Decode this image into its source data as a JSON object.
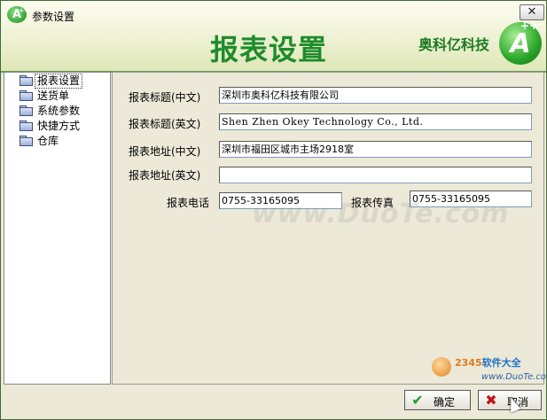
{
  "window": {
    "title": "参数设置",
    "close_label": "✕"
  },
  "banner": {
    "page_title": "报表设置",
    "company": "奥科亿科技",
    "logo_letter": "A",
    "logo_plus": "++"
  },
  "sidebar": {
    "items": [
      {
        "label": "报表设置",
        "selected": true
      },
      {
        "label": "送货单",
        "selected": false
      },
      {
        "label": "系统参数",
        "selected": false
      },
      {
        "label": "快捷方式",
        "selected": false
      },
      {
        "label": "仓库",
        "selected": false
      }
    ]
  },
  "form": {
    "title_cn_label": "报表标题(中文)",
    "title_cn_value": "深圳市奥科亿科技有限公司",
    "title_en_label": "报表标题(英文)",
    "title_en_value": "Shen Zhen Okey Technology Co., Ltd.",
    "addr_cn_label": "报表地址(中文)",
    "addr_cn_value": "深圳市福田区城市主场2918室",
    "addr_en_label": "报表地址(英文)",
    "addr_en_value": "",
    "phone_label": "报表电话",
    "phone_value": "0755-33165095",
    "fax_label": "报表传真",
    "fax_value": "0755-33165095"
  },
  "watermark": "www.DuoTe.com",
  "buttons": {
    "ok_label": "确定",
    "cancel_label": "取消"
  },
  "site_badge": {
    "brand_num": "2345",
    "brand_text": "软件大全",
    "url": "www.DuoTe.com"
  },
  "colors": {
    "title_green": "#1d8c2a",
    "banner_bg": "#f1f3d8",
    "window_bg": "#ece9d8"
  }
}
